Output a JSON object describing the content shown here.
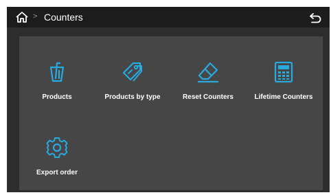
{
  "header": {
    "breadcrumb_sep": ">",
    "title": "Counters"
  },
  "icons": {
    "home": "home-icon",
    "back": "back-icon"
  },
  "accent_color": "#28a9e0",
  "tiles": [
    {
      "label": "Products",
      "icon": "cup-icon"
    },
    {
      "label": "Products by type",
      "icon": "tags-icon"
    },
    {
      "label": "Reset Counters",
      "icon": "eraser-icon"
    },
    {
      "label": "Lifetime Counters",
      "icon": "calculator-icon"
    },
    {
      "label": "Export order",
      "icon": "gear-icon"
    }
  ]
}
